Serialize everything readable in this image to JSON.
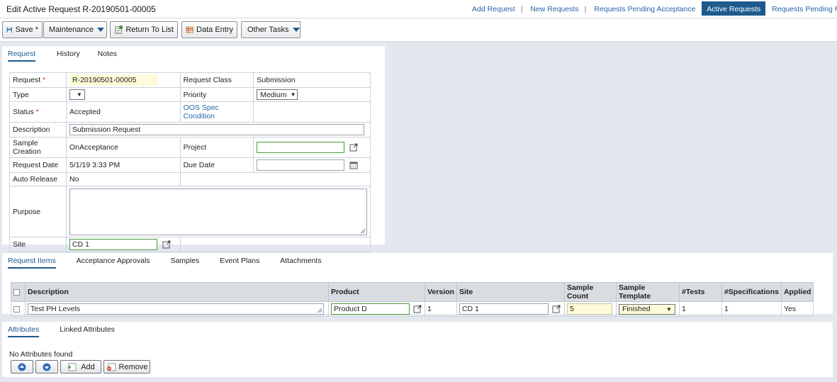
{
  "header": {
    "title": "Edit Active Request R-20190501-00005",
    "links": [
      {
        "label": "Add Request"
      },
      {
        "label": "New Requests"
      },
      {
        "label": "Requests Pending Acceptance"
      },
      {
        "label": "Active Requests",
        "active": true
      },
      {
        "label": "Requests Pending Releas"
      }
    ]
  },
  "toolbar": {
    "save": "Save *",
    "maintenance": "Maintenance",
    "return": "Return To List",
    "data_entry": "Data Entry",
    "other_tasks": "Other Tasks"
  },
  "request_tabs": [
    "Request",
    "History",
    "Notes"
  ],
  "form": {
    "request_label": "Request",
    "request_value": "R-20190501-00005",
    "request_class_label": "Request Class",
    "request_class_value": "Submission",
    "type_label": "Type",
    "type_value": "",
    "priority_label": "Priority",
    "priority_value": "Medium",
    "status_label": "Status",
    "status_value": "Accepted",
    "oos_label": "OOS Spec Condition",
    "description_label": "Description",
    "description_value": "Submission Request",
    "sample_creation_label": "Sample Creation",
    "sample_creation_value": "OnAcceptance",
    "project_label": "Project",
    "project_value": "",
    "request_date_label": "Request Date",
    "request_date_value": "5/1/19 3:33 PM",
    "due_date_label": "Due Date",
    "due_date_value": "",
    "auto_release_label": "Auto Release",
    "auto_release_value": "No",
    "purpose_label": "Purpose",
    "purpose_value": "",
    "site_label": "Site",
    "site_value": "CD 1",
    "required_mark": "*"
  },
  "items_tabs": [
    "Request Items",
    "Acceptance Approvals",
    "Samples",
    "Event Plans",
    "Attachments"
  ],
  "items_table": {
    "headers": [
      "Description",
      "Product",
      "Version",
      "Site",
      "Sample Count",
      "Sample Template",
      "#Tests",
      "#Specifications",
      "Applied"
    ],
    "rows": [
      {
        "description": "Test PH Levels",
        "product": "Product D",
        "version": "1",
        "site": "CD 1",
        "sample_count": "5",
        "sample_template": "Finished",
        "tests": "1",
        "specifications": "1",
        "applied": "Yes"
      }
    ]
  },
  "attr_tabs": [
    "Attributes",
    "Linked Attributes"
  ],
  "attributes": {
    "empty_text": "No Attributes found",
    "add": "Add",
    "remove": "Remove"
  },
  "colors": {
    "accent": "#1d5a8e",
    "link": "#2864a8",
    "required": "#c0392b",
    "valid_border": "#4a9a3a"
  }
}
